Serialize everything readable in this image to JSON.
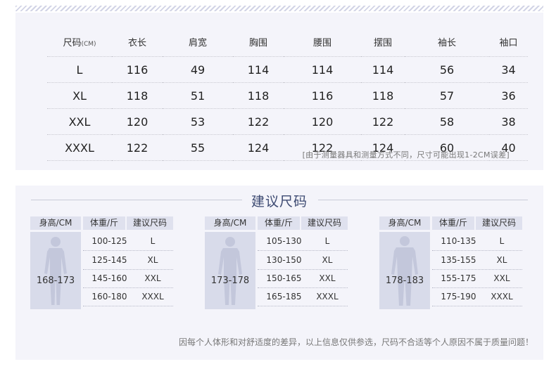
{
  "size_table": {
    "unit": "(CM)",
    "headers": [
      "尺码",
      "衣长",
      "肩宽",
      "胸围",
      "腰围",
      "摆围",
      "袖长",
      "袖口"
    ],
    "rows": [
      [
        "L",
        "116",
        "49",
        "114",
        "114",
        "114",
        "56",
        "34"
      ],
      [
        "XL",
        "118",
        "51",
        "118",
        "116",
        "118",
        "57",
        "36"
      ],
      [
        "XXL",
        "120",
        "53",
        "122",
        "120",
        "122",
        "58",
        "38"
      ],
      [
        "XXXL",
        "122",
        "55",
        "124",
        "122",
        "124",
        "60",
        "40"
      ]
    ],
    "note": "[由于测量器具和测量方式不同，尺寸可能出现1-2CM误差]"
  },
  "recommend": {
    "title": "建议尺码",
    "headers": [
      "身高/CM",
      "体重/斤",
      "建议尺码"
    ],
    "blocks": [
      {
        "height": "168-173",
        "rows": [
          [
            "100-125",
            "L"
          ],
          [
            "125-145",
            "XL"
          ],
          [
            "145-160",
            "XXL"
          ],
          [
            "160-180",
            "XXXL"
          ]
        ]
      },
      {
        "height": "173-178",
        "rows": [
          [
            "105-130",
            "L"
          ],
          [
            "130-150",
            "XL"
          ],
          [
            "150-165",
            "XXL"
          ],
          [
            "165-185",
            "XXXL"
          ]
        ]
      },
      {
        "height": "178-183",
        "rows": [
          [
            "110-135",
            "L"
          ],
          [
            "135-155",
            "XL"
          ],
          [
            "155-175",
            "XXL"
          ],
          [
            "175-190",
            "XXXL"
          ]
        ]
      }
    ],
    "disclaimer": "因每个人体形和对舒适度的差异，以上信息仅供参选，尺码不合适等个人原因不属于质量问题！"
  },
  "colors": {
    "panel": "#f4f4fa",
    "figure_bg": "#d8dbea",
    "silhouette": "#c3c7db",
    "title": "#3d4a72"
  },
  "icons": [
    "person-silhouette-icon"
  ]
}
